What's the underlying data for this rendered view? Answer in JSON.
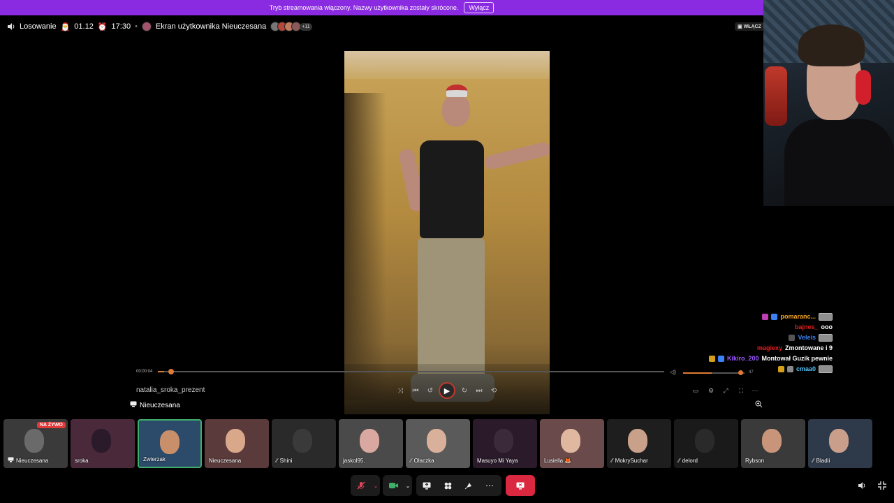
{
  "banner": {
    "text": "Tryb streamowania włączony. Nazwy użytkownika zostały skrócone.",
    "button": "Wyłącz"
  },
  "topbar": {
    "title": "Losowanie",
    "date": "01.12",
    "time": "17:30",
    "screen_label": "Ekran użytkownika Nieuczesana",
    "more_count": "+11",
    "enable_label": "WŁĄCZ"
  },
  "player": {
    "current_time": "00:00:04",
    "progress": 0.012,
    "volume_level": 0.47,
    "volume_value": "47",
    "filename": "natalia_sroka_prezent",
    "screen_owner": "Nieuczesana"
  },
  "chat": [
    {
      "user": "pomaranc...",
      "color": "#f5a623",
      "message": "",
      "emote": true,
      "badges": [
        "#c03fb5",
        "#3b82f6"
      ]
    },
    {
      "user": "bajnes_",
      "color": "#e02020",
      "message": "ooo",
      "emote": false,
      "badges": []
    },
    {
      "user": "Veleis",
      "color": "#3b82f6",
      "message": "",
      "emote": true,
      "badges": [
        "#555555"
      ]
    },
    {
      "user": "magiexy",
      "color": "#e02020",
      "message": "Zmontowane i 9",
      "emote": false,
      "badges": []
    },
    {
      "user": "Kikiro_200",
      "color": "#9b59ff",
      "message": "Montował Guzik pewnie",
      "emote": false,
      "badges": [
        "#d4a017",
        "#3b82f6"
      ]
    },
    {
      "user": "cmaa0",
      "color": "#4fc3f7",
      "message": "",
      "emote": true,
      "badges": [
        "#d4a017",
        "#888888"
      ]
    }
  ],
  "participants": [
    {
      "name": "Nieuczesana",
      "live": "NA ŻYWO",
      "icon": "screen-share-icon",
      "muted": false,
      "face": "#6a6a6a",
      "bg": "#3a3a3a"
    },
    {
      "name": "sroka",
      "live": "",
      "icon": "",
      "muted": false,
      "face": "#2a1a2a",
      "bg": "#4a2a3a"
    },
    {
      "name": "Zwierzak",
      "live": "",
      "icon": "",
      "muted": false,
      "face": "#c98f6a",
      "bg": "#2c4a6a",
      "active": true
    },
    {
      "name": "Nieuczesana",
      "live": "",
      "icon": "",
      "muted": false,
      "face": "#d9a88a",
      "bg": "#5a3a3a"
    },
    {
      "name": "Shini",
      "live": "",
      "icon": "",
      "muted": true,
      "face": "#3a3a3a",
      "bg": "#2a2a2a"
    },
    {
      "name": "jaskol95.",
      "live": "",
      "icon": "",
      "muted": false,
      "face": "#d9a8a0",
      "bg": "#4a4a4a"
    },
    {
      "name": "Olaczka",
      "live": "",
      "icon": "",
      "muted": true,
      "face": "#d9b09a",
      "bg": "#5a5a5a"
    },
    {
      "name": "Masuyo Mi Yaya",
      "live": "",
      "icon": "",
      "muted": false,
      "face": "#3a2a3a",
      "bg": "#2a1a2a"
    },
    {
      "name": "Lusiella 🦊",
      "live": "",
      "icon": "",
      "muted": false,
      "face": "#e0b8a0",
      "bg": "#6a4a4a"
    },
    {
      "name": "MokrySuchar",
      "live": "",
      "icon": "",
      "muted": true,
      "face": "#c9a08a",
      "bg": "#1e1e1e"
    },
    {
      "name": "delord",
      "live": "",
      "icon": "",
      "muted": true,
      "face": "#2a2a2a",
      "bg": "#1a1a1a"
    },
    {
      "name": "Rybson",
      "live": "",
      "icon": "",
      "muted": false,
      "face": "#c9957a",
      "bg": "#3a3a3a"
    },
    {
      "name": "Bladii",
      "live": "",
      "icon": "",
      "muted": true,
      "face": "#c99f8c",
      "bg": "#2e3a4a"
    }
  ],
  "colors": {
    "banner": "#8a2be2",
    "accent": "#e07b33",
    "leave": "#d9283f",
    "active_border": "#3fae6a",
    "live": "#e03b3b"
  }
}
